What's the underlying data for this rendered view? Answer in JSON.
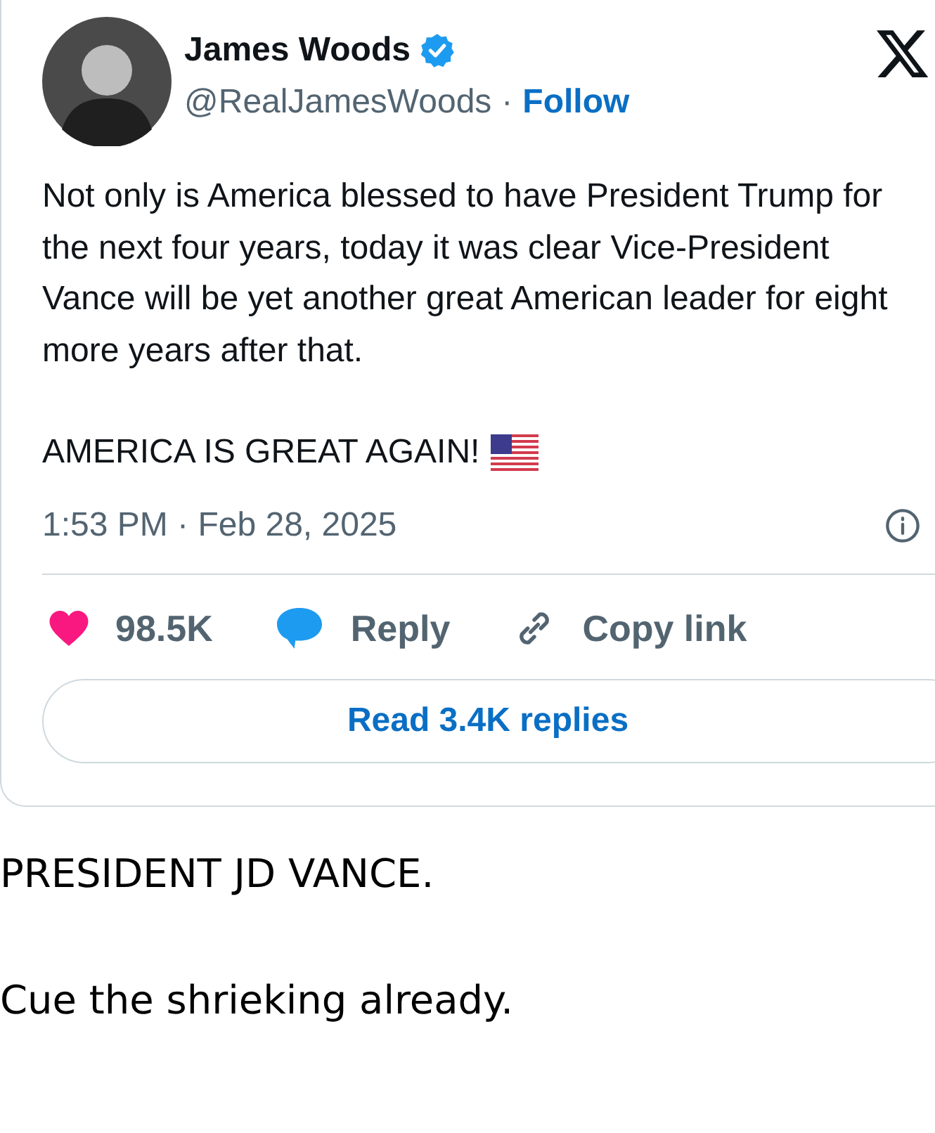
{
  "tweet": {
    "author": {
      "name": "James Woods",
      "verified": true,
      "handle": "@RealJamesWoods",
      "separator": "·",
      "follow": "Follow"
    },
    "body": "Not only is America blessed to have President Trump for the next four years, today it was clear Vice-President Vance will be yet another great American leader for eight more years after that.",
    "body_2": "AMERICA IS GREAT AGAIN!",
    "timestamp": "1:53 PM · Feb 28, 2025",
    "actions": [
      {
        "kind": "like",
        "label": "98.5K"
      },
      {
        "kind": "reply",
        "label": "Reply"
      },
      {
        "kind": "copy",
        "label": "Copy link"
      }
    ],
    "read_replies": "Read 3.4K replies"
  },
  "caption": [
    "PRESIDENT JD VANCE.",
    "Cue the shrieking already."
  ]
}
